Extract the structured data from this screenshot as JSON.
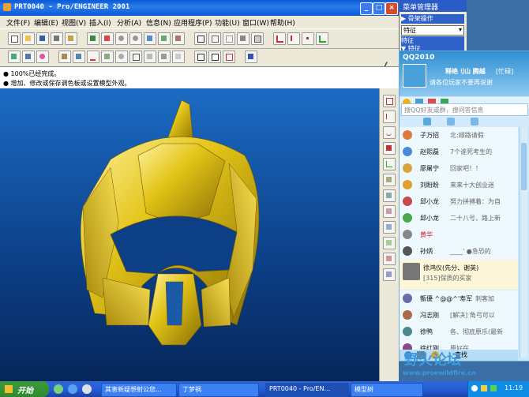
{
  "window": {
    "title": "PRT0040 - Pro/ENGINEER 2001",
    "controls": {
      "minimize": "_",
      "maximize": "□",
      "close": "×"
    }
  },
  "menubar": {
    "items": [
      "文件(F)",
      "编辑(E)",
      "视图(V)",
      "插入(I)",
      "分析(A)",
      "信息(N)",
      "应用程序(P)",
      "功能(U)",
      "窗口(W)",
      "帮助(H)"
    ]
  },
  "messages": [
    "● 100%已经完成。",
    "● 增加、修改或保存调色板或设置模型外观。"
  ],
  "menu_manager": {
    "title": "菜单管理器",
    "items": [
      "▶ 骨架操作",
      "特征",
      "▼ 特征"
    ],
    "dropdown_value": "特征",
    "partial_label": "特征"
  },
  "qq": {
    "title": "QQ2010",
    "nickname": "释绝刂山 腾越",
    "status_badge": "[忙碌]",
    "signature": "请各位玩家不要再说谢",
    "search_placeholder": "搜QQ好友或群，搜问答信息",
    "contacts": [
      {
        "name": "子万招",
        "status": "北:顺路请假"
      },
      {
        "name": "赵熙磊",
        "status": "7个谁死考生的"
      },
      {
        "name": "廖屠宁",
        "status": "回家吧！！"
      },
      {
        "name": "刘盼盼",
        "status": "来来十大创业迷"
      },
      {
        "name": "邱小龙",
        "status": "努力拼搏着：为自"
      },
      {
        "name": "邱小龙",
        "status": "二十八号，路上新"
      },
      {
        "name": "黄华",
        "status": ""
      },
      {
        "name": "孙炳",
        "status": "____' ●急恐的"
      },
      {
        "name": "徐鸿仪(先分、谢英)",
        "status": "[315]保质的买家"
      },
      {
        "name": "甑優 ^@@^'寿军",
        "status": "刺客加"
      },
      {
        "name": "冯志刚",
        "status": "[解决] 角弓可以"
      },
      {
        "name": "徐鸭",
        "status": "各、彻底原乐(最新"
      },
      {
        "name": "徐红刚",
        "status": "原好在"
      }
    ],
    "find_label": "查找"
  },
  "taskbar": {
    "start_label": "开始",
    "tasks": [
      "其害新疑想射公您...",
      "丁梦祸",
      "PRT0040 - Pro/EN...",
      "模型树"
    ],
    "clock": "11:19"
  },
  "watermark": {
    "text": "野火论坛",
    "url": "www.proewildfire.cn"
  },
  "colors": {
    "titlebar": "#0a5ad8",
    "graphics_bg": "#0c3f86",
    "model": "#e3c417",
    "qq_bg": "#c9e7fb"
  }
}
